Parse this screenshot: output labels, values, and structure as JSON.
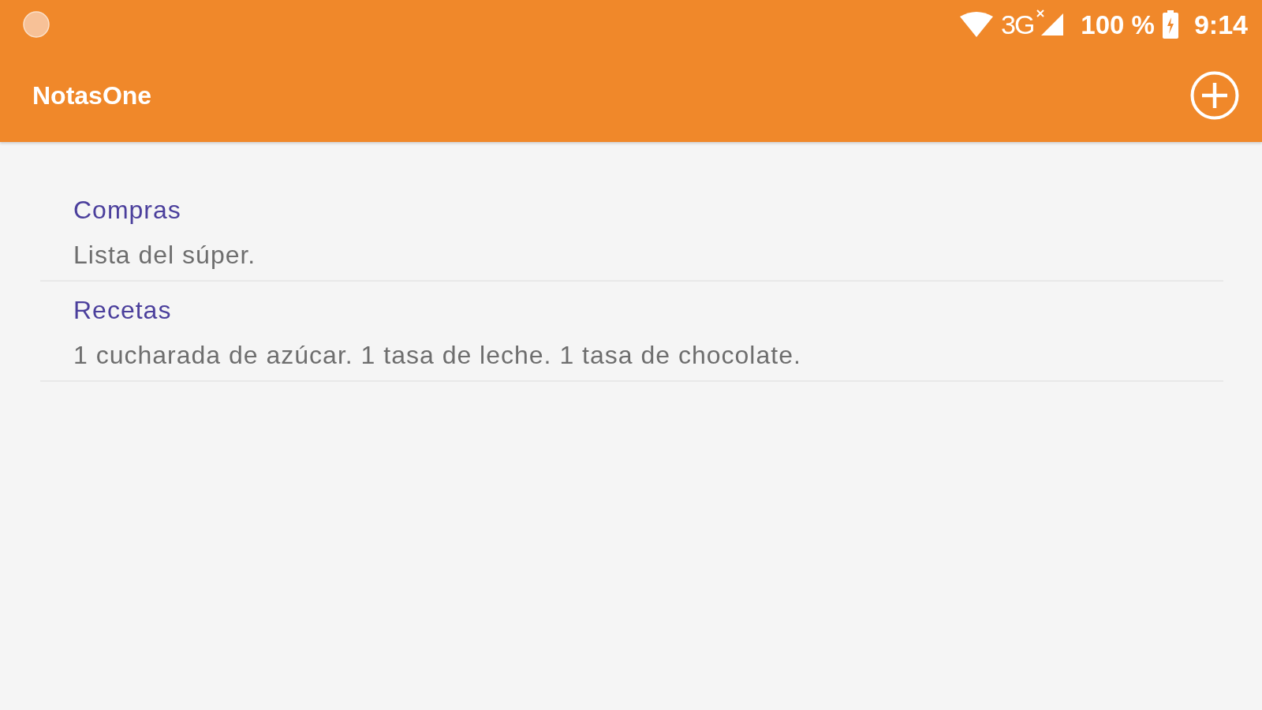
{
  "status_bar": {
    "network": "3G",
    "battery": "100 %",
    "time": "9:14"
  },
  "app_bar": {
    "title": "NotasOne"
  },
  "notes": [
    {
      "title": "Compras",
      "body": "Lista del súper."
    },
    {
      "title": "Recetas",
      "body": "1 cucharada de azúcar. 1 tasa de leche. 1 tasa de chocolate."
    }
  ]
}
